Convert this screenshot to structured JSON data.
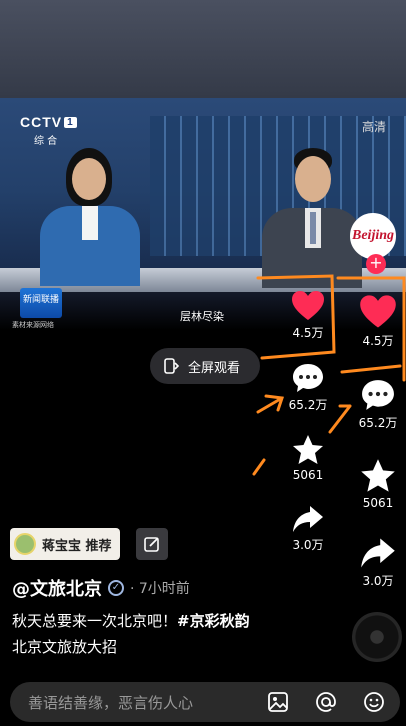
{
  "video": {
    "channel": "CCTV",
    "channel_num": "1",
    "channel_sub": "综 合",
    "quality": "高清",
    "show_logo": "新闻联播",
    "source": "素材来源网络",
    "ticker": "层林尽染"
  },
  "fullscreen_label": "全屏观看",
  "sidebars": [
    {
      "likes": "4.5万",
      "comments": "65.2万",
      "favorites": "5061",
      "shares": "3.0万"
    },
    {
      "likes": "4.5万",
      "comments": "65.2万",
      "favorites": "5061",
      "shares": "3.0万"
    }
  ],
  "profile": {
    "avatar_text": "Beijing"
  },
  "recommend": {
    "label": "蒋宝宝 推荐"
  },
  "post": {
    "author": "@文旅北京",
    "time": "· 7小时前",
    "caption_text": "秋天总要来一次北京吧！",
    "caption_tag": "#京彩秋韵",
    "caption_line2": "北京文旅放大招"
  },
  "comment_bar": {
    "placeholder": "善语结善缘，恶言伤人心"
  },
  "colors": {
    "like": "#fe2c55",
    "annotation": "#ff8a1f",
    "background": "#000000"
  }
}
